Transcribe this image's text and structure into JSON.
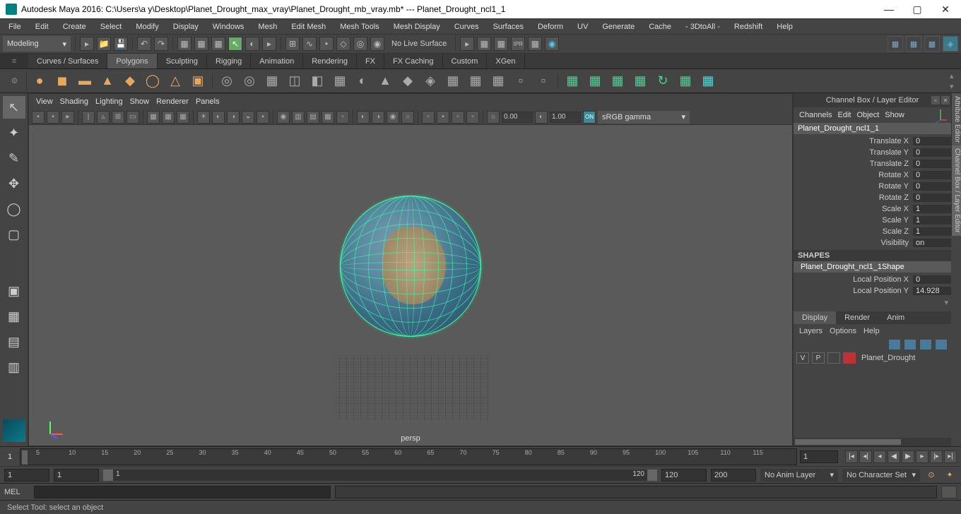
{
  "title": "Autodesk Maya 2016: C:\\Users\\a y\\Desktop\\Planet_Drought_max_vray\\Planet_Drought_mb_vray.mb*  ---  Planet_Drought_ncl1_1",
  "menus": [
    "File",
    "Edit",
    "Create",
    "Select",
    "Modify",
    "Display",
    "Windows",
    "Mesh",
    "Edit Mesh",
    "Mesh Tools",
    "Mesh Display",
    "Curves",
    "Surfaces",
    "Deform",
    "UV",
    "Generate",
    "Cache",
    "- 3DtoAll -",
    "Redshift",
    "Help"
  ],
  "workspace": "Modeling",
  "noLiveSurface": "No Live Surface",
  "shelfTabs": [
    "Curves / Surfaces",
    "Polygons",
    "Sculpting",
    "Rigging",
    "Animation",
    "Rendering",
    "FX",
    "FX Caching",
    "Custom",
    "XGen"
  ],
  "activeShelf": 1,
  "panelMenu": [
    "View",
    "Shading",
    "Lighting",
    "Show",
    "Renderer",
    "Panels"
  ],
  "panelTools": {
    "val1": "0.00",
    "val2": "1.00",
    "colorProfile": "sRGB gamma"
  },
  "viewportLabel": "persp",
  "channelBox": {
    "title": "Channel Box / Layer Editor",
    "menus": [
      "Channels",
      "Edit",
      "Object",
      "Show"
    ],
    "objectName": "Planet_Drought_ncl1_1",
    "attrs": [
      {
        "lbl": "Translate X",
        "val": "0"
      },
      {
        "lbl": "Translate Y",
        "val": "0"
      },
      {
        "lbl": "Translate Z",
        "val": "0"
      },
      {
        "lbl": "Rotate X",
        "val": "0"
      },
      {
        "lbl": "Rotate Y",
        "val": "0"
      },
      {
        "lbl": "Rotate Z",
        "val": "0"
      },
      {
        "lbl": "Scale X",
        "val": "1"
      },
      {
        "lbl": "Scale Y",
        "val": "1"
      },
      {
        "lbl": "Scale Z",
        "val": "1"
      },
      {
        "lbl": "Visibility",
        "val": "on"
      }
    ],
    "shapesHead": "SHAPES",
    "shapeName": "Planet_Drought_ncl1_1Shape",
    "shapeAttrs": [
      {
        "lbl": "Local Position X",
        "val": "0"
      },
      {
        "lbl": "Local Position Y",
        "val": "14.928"
      }
    ],
    "layerTabs": [
      "Display",
      "Render",
      "Anim"
    ],
    "layerMenu": [
      "Layers",
      "Options",
      "Help"
    ],
    "layerRow": {
      "v": "V",
      "p": "P",
      "name": "Planet_Drought"
    }
  },
  "sideTabs": [
    "Attribute Editor",
    "Channel Box / Layer Editor"
  ],
  "timeline": {
    "current": "1",
    "ticks": [
      "5",
      "10",
      "15",
      "20",
      "25",
      "30",
      "35",
      "40",
      "45",
      "50",
      "55",
      "60",
      "65",
      "70",
      "75",
      "80",
      "85",
      "90",
      "95",
      "100",
      "105",
      "110",
      "115"
    ],
    "endField": "1"
  },
  "range": {
    "start1": "1",
    "start2": "1",
    "sliderStart": "1",
    "sliderEnd": "120",
    "end1": "120",
    "end2": "200",
    "animLayer": "No Anim Layer",
    "charSet": "No Character Set"
  },
  "cmd": {
    "label": "MEL"
  },
  "status": "Select Tool: select an object"
}
